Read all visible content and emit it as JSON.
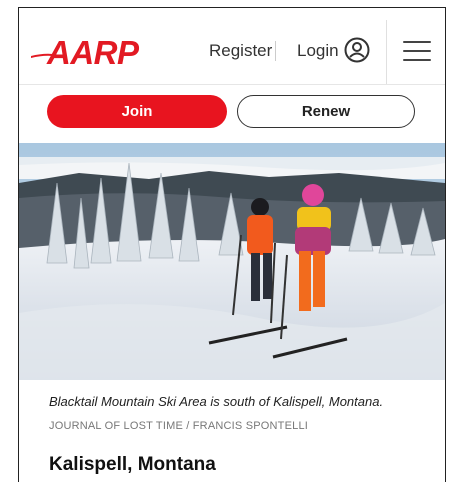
{
  "header": {
    "logo_text": "AARP",
    "register_label": "Register",
    "login_label": "Login"
  },
  "actions": {
    "join_label": "Join",
    "renew_label": "Renew"
  },
  "colors": {
    "brand_red": "#e21a23",
    "join_button": "#e8141f"
  },
  "article": {
    "photo_caption": "Blacktail Mountain Ski Area is south of Kalispell, Montana.",
    "photo_credit": "JOURNAL OF LOST TIME / FRANCIS SPONTELLI",
    "headline": "Kalispell, Montana"
  },
  "icons": {
    "user": "user-circle-icon",
    "menu": "hamburger-menu-icon"
  }
}
